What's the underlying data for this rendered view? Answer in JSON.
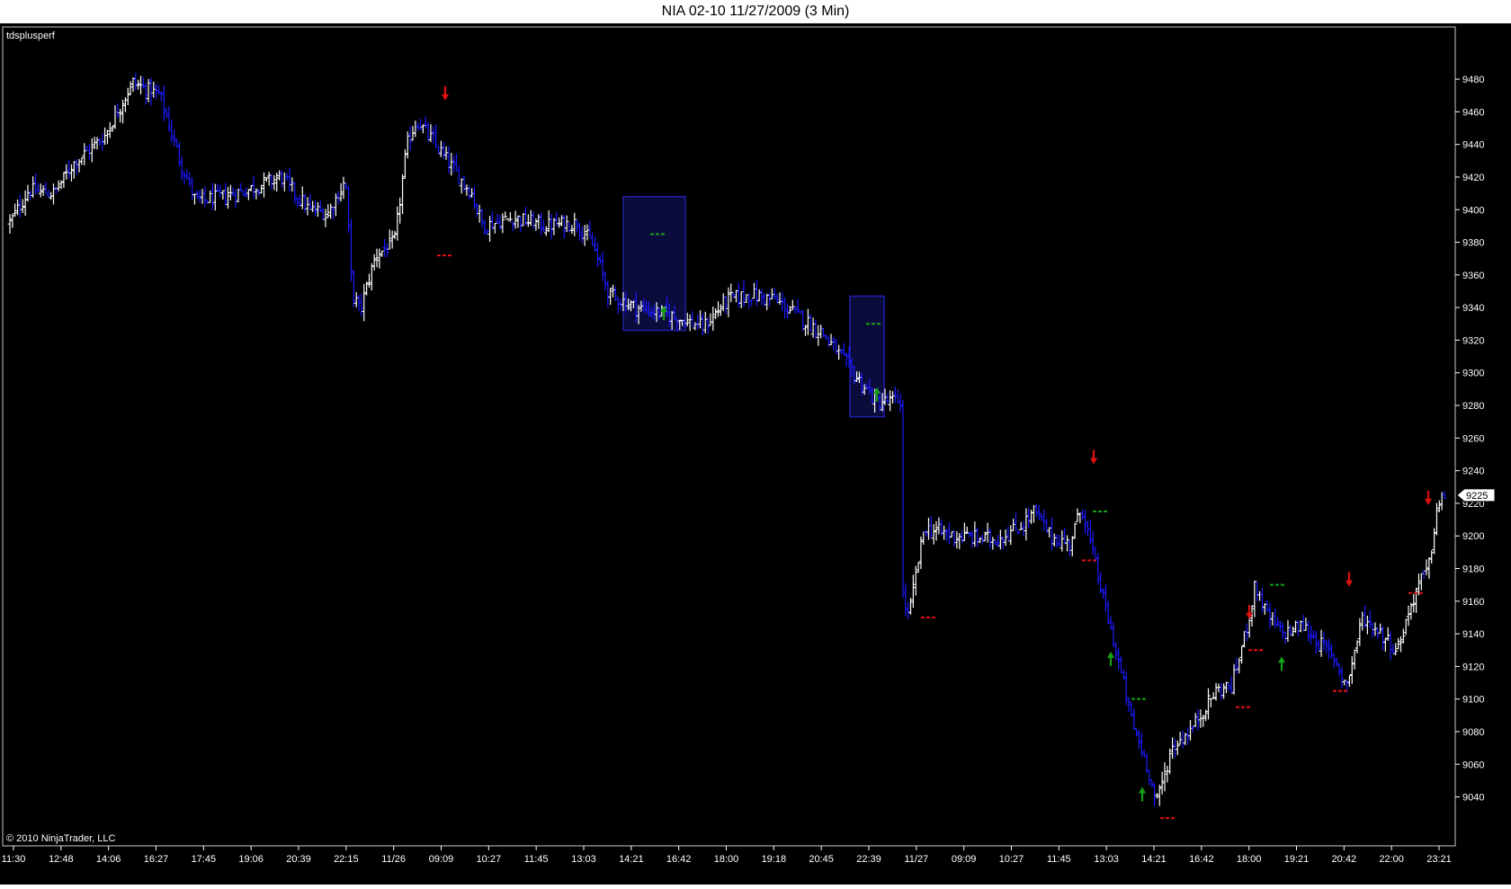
{
  "window": {
    "title": "NIA 02-10  11/27/2009 (3 Min)"
  },
  "panel": {
    "indicator": "tdsplusperf",
    "copyright": "© 2010 NinjaTrader, LLC",
    "last_price": "9225"
  },
  "colors": {
    "background": "#000000",
    "bar_up": "#ffffff",
    "bar_down": "#1a1aff",
    "setup_count": "#16a016",
    "sell_arrow": "#e01010",
    "buy_arrow": "#16a016",
    "tdst_line": "#e01010",
    "zone_box": "#1f1fa8"
  },
  "chart_data": {
    "type": "bar",
    "title": "",
    "xlabel": "",
    "ylabel": "",
    "ylim": [
      9010,
      9512
    ],
    "y_ticks": [
      9040,
      9060,
      9080,
      9100,
      9120,
      9140,
      9160,
      9180,
      9200,
      9220,
      9240,
      9260,
      9280,
      9300,
      9320,
      9340,
      9360,
      9380,
      9400,
      9420,
      9440,
      9460,
      9480
    ],
    "x_ticks": [
      "11:30",
      "12:48",
      "14:06",
      "16:27",
      "17:45",
      "19:06",
      "20:39",
      "22:15",
      "11/26",
      "09:09",
      "10:27",
      "11:45",
      "13:03",
      "14:21",
      "16:42",
      "18:00",
      "19:18",
      "20:45",
      "22:39",
      "11/27",
      "09:09",
      "10:27",
      "11:45",
      "13:03",
      "14:21",
      "16:42",
      "18:00",
      "19:21",
      "20:42",
      "22:00",
      "23:21"
    ],
    "bar_count": 560,
    "price_path": [
      [
        0,
        9392
      ],
      [
        12,
        9412
      ],
      [
        28,
        9410
      ],
      [
        40,
        9428
      ],
      [
        60,
        9445
      ],
      [
        78,
        9478
      ],
      [
        95,
        9470
      ],
      [
        108,
        9430
      ],
      [
        118,
        9405
      ],
      [
        135,
        9408
      ],
      [
        150,
        9412
      ],
      [
        172,
        9420
      ],
      [
        190,
        9400
      ],
      [
        202,
        9398
      ],
      [
        213,
        9418
      ],
      [
        217,
        9350
      ],
      [
        222,
        9338
      ],
      [
        232,
        9372
      ],
      [
        244,
        9380
      ],
      [
        252,
        9440
      ],
      [
        258,
        9455
      ],
      [
        270,
        9440
      ],
      [
        285,
        9420
      ],
      [
        293,
        9410
      ],
      [
        300,
        9390
      ],
      [
        320,
        9395
      ],
      [
        340,
        9390
      ],
      [
        360,
        9392
      ],
      [
        370,
        9378
      ],
      [
        380,
        9348
      ],
      [
        398,
        9340
      ],
      [
        420,
        9335
      ],
      [
        440,
        9328
      ],
      [
        455,
        9345
      ],
      [
        470,
        9348
      ],
      [
        485,
        9345
      ],
      [
        500,
        9335
      ],
      [
        515,
        9325
      ],
      [
        535,
        9300
      ],
      [
        550,
        9282
      ],
      [
        565,
        9283
      ],
      [
        566,
        9165
      ],
      [
        570,
        9150
      ],
      [
        580,
        9205
      ],
      [
        600,
        9200
      ],
      [
        625,
        9198
      ],
      [
        640,
        9205
      ],
      [
        650,
        9215
      ],
      [
        660,
        9200
      ],
      [
        672,
        9195
      ],
      [
        680,
        9218
      ],
      [
        688,
        9185
      ],
      [
        695,
        9155
      ],
      [
        702,
        9128
      ],
      [
        712,
        9085
      ],
      [
        722,
        9058
      ],
      [
        727,
        9035
      ],
      [
        737,
        9070
      ],
      [
        750,
        9082
      ],
      [
        765,
        9105
      ],
      [
        775,
        9108
      ],
      [
        785,
        9145
      ],
      [
        790,
        9170
      ],
      [
        797,
        9152
      ],
      [
        807,
        9140
      ],
      [
        820,
        9145
      ],
      [
        840,
        9125
      ],
      [
        848,
        9108
      ],
      [
        858,
        9150
      ],
      [
        870,
        9140
      ],
      [
        880,
        9130
      ],
      [
        893,
        9170
      ],
      [
        900,
        9180
      ],
      [
        905,
        9215
      ],
      [
        910,
        9225
      ]
    ],
    "annotations": {
      "sell_arrows": [
        9468,
        9245,
        9150,
        9170,
        9220
      ],
      "buy_arrows": [
        9340,
        9290,
        9128,
        9045,
        9125
      ],
      "tdst_levels": [
        9372,
        9385,
        9330,
        9150,
        9215,
        9185,
        9100,
        9027,
        9095,
        9130,
        9170,
        9105,
        9165
      ],
      "zones": [
        {
          "from": "14:21",
          "to": "16:42",
          "high": 9408,
          "low": 9326
        },
        {
          "from": "22:39",
          "to": "11/27",
          "high": 9347,
          "low": 9273
        }
      ]
    }
  }
}
